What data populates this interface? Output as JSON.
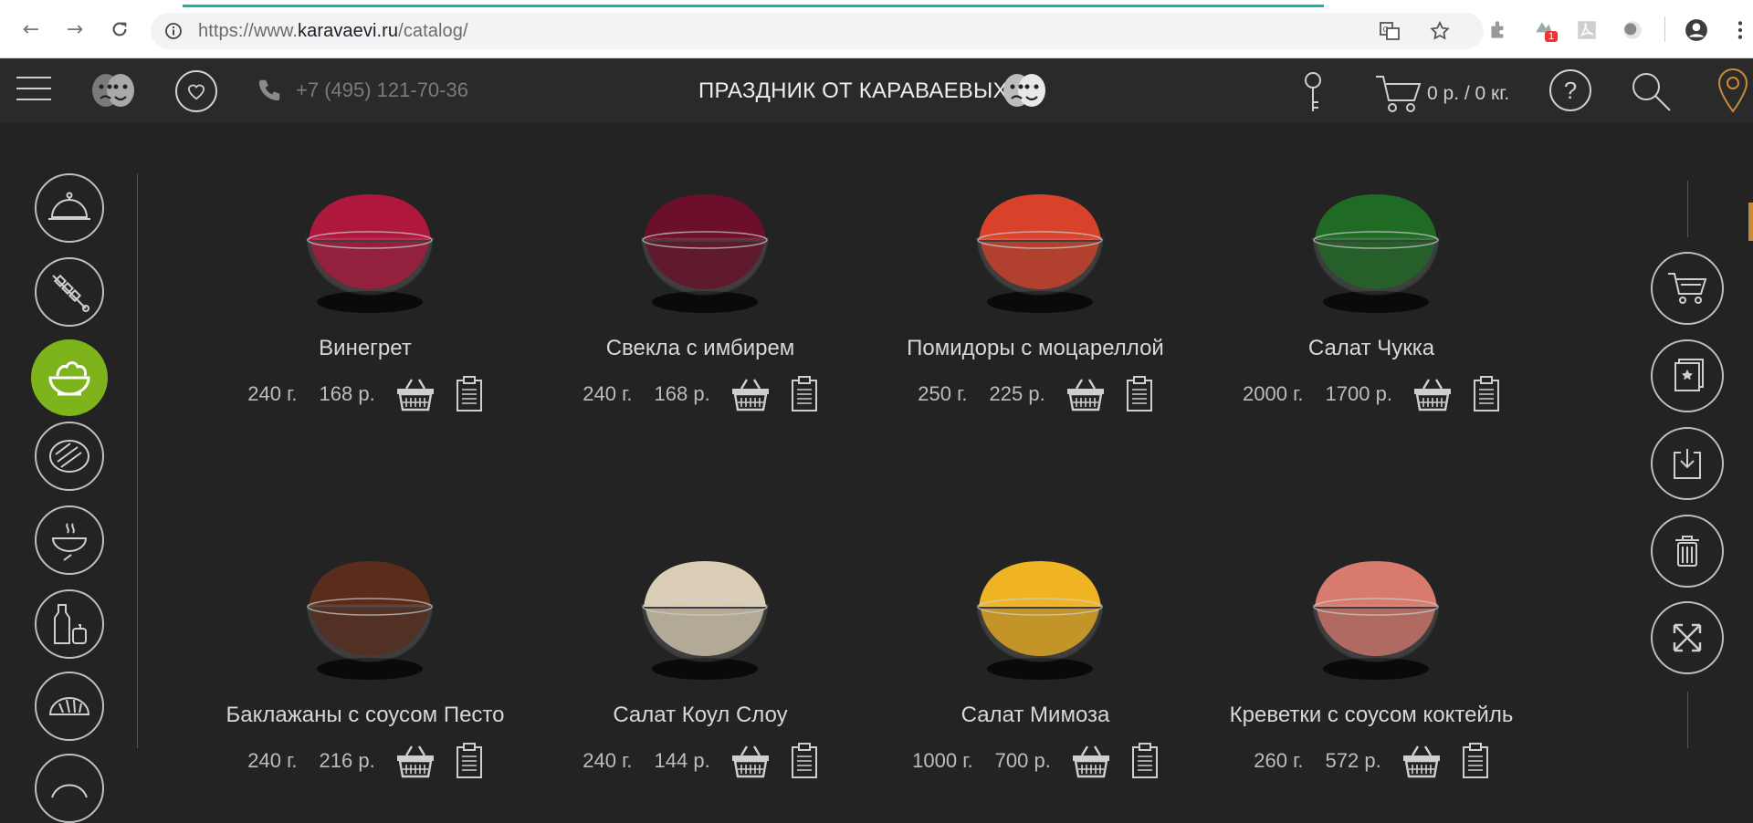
{
  "browser": {
    "url_prefix": "https://www.",
    "url_domain": "karavaevi.ru",
    "url_path": "/catalog/",
    "ext_badge": "1"
  },
  "header": {
    "phone": "+7 (495) 121-70-36",
    "title": "ПРАЗДНИК ОТ КАРАВАЕВЫХ",
    "cart_summary": "0 р. / 0 кг."
  },
  "categories": [
    {
      "icon": "cloche-icon",
      "active": false
    },
    {
      "icon": "skewer-icon",
      "active": false
    },
    {
      "icon": "salad-bowl-icon",
      "active": true
    },
    {
      "icon": "steak-icon",
      "active": false
    },
    {
      "icon": "soup-bowl-icon",
      "active": false
    },
    {
      "icon": "bottles-icon",
      "active": false
    },
    {
      "icon": "bread-icon",
      "active": false
    },
    {
      "icon": "pastry-icon",
      "active": false
    }
  ],
  "actions": [
    {
      "icon": "cart-icon"
    },
    {
      "icon": "bookmark-book-icon"
    },
    {
      "icon": "download-icon"
    },
    {
      "icon": "trash-icon"
    },
    {
      "icon": "fullscreen-icon"
    }
  ],
  "products": [
    {
      "name": "Винегрет",
      "weight": "240 г.",
      "price": "168 р.",
      "color": "#b0173c"
    },
    {
      "name": "Свекла с имбирем",
      "weight": "240 г.",
      "price": "168 р.",
      "color": "#6b0f2a"
    },
    {
      "name": "Помидоры с моцареллой",
      "weight": "250 г.",
      "price": "225 р.",
      "color": "#d8412a"
    },
    {
      "name": "Салат Чукка",
      "weight": "2000 г.",
      "price": "1700 р.",
      "color": "#1f6b24"
    },
    {
      "name": "Баклажаны с соусом Песто",
      "weight": "240 г.",
      "price": "216 р.",
      "color": "#5a2c1c"
    },
    {
      "name": "Салат Коул Слоу",
      "weight": "240 г.",
      "price": "144 р.",
      "color": "#d9cdb5"
    },
    {
      "name": "Салат Мимоза",
      "weight": "1000 г.",
      "price": "700 р.",
      "color": "#f0b323"
    },
    {
      "name": "Креветки с соусом коктейль",
      "weight": "260 г.",
      "price": "572 р.",
      "color": "#d87a6e"
    }
  ],
  "colors": {
    "accent_green": "#7db31b",
    "background": "#232323",
    "header": "#2a2a2a",
    "location_pin": "#c98a3a",
    "progress": "#1bb3a8"
  }
}
